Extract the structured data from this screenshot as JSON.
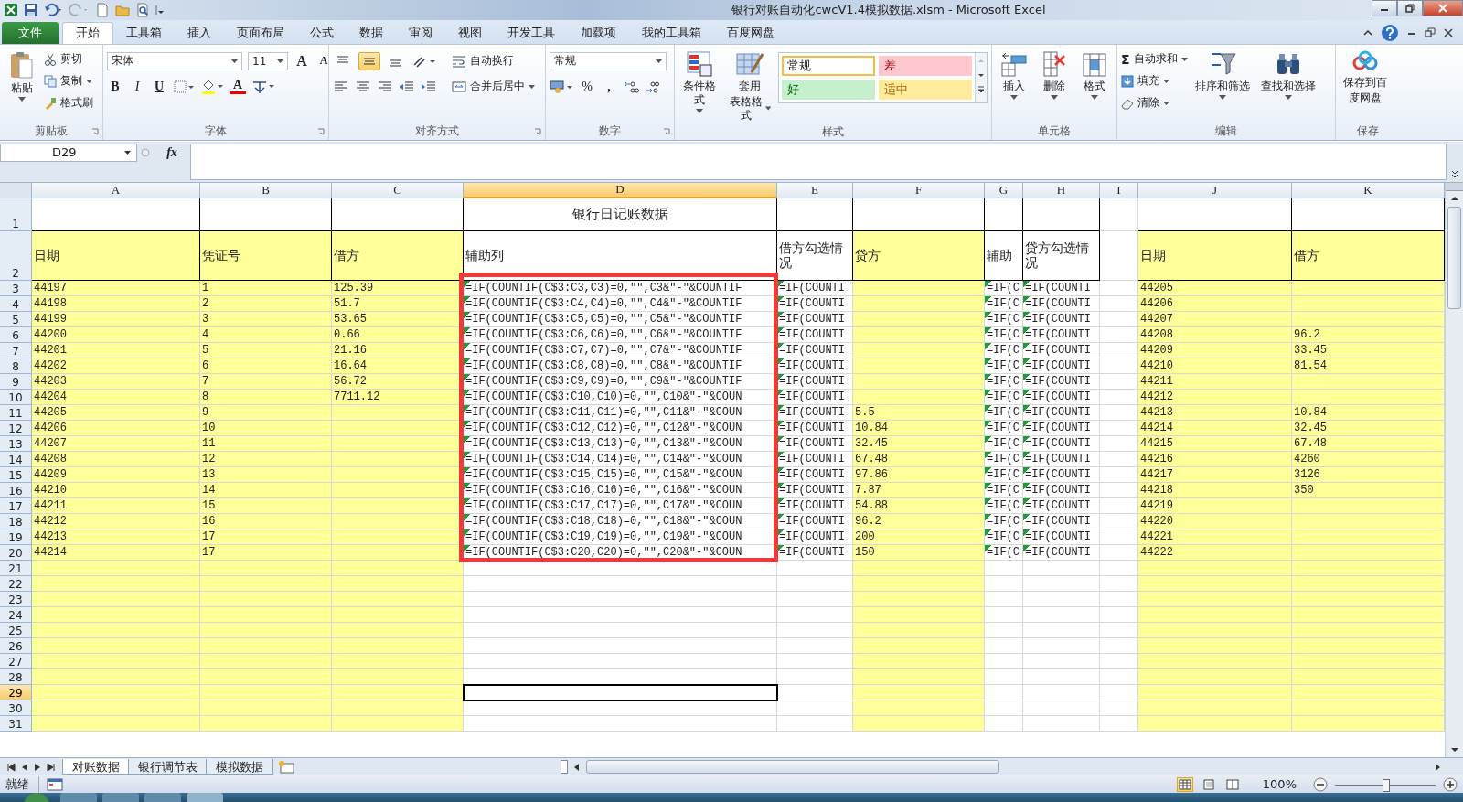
{
  "window": {
    "title": "银行对账自动化cwcV1.4模拟数据.xlsm  -  Microsoft Excel"
  },
  "ribbon_tabs": [
    {
      "label": "文件",
      "kind": "file",
      "selected": false
    },
    {
      "label": "开始",
      "kind": "tab",
      "selected": true
    },
    {
      "label": "工具箱",
      "kind": "tab",
      "selected": false
    },
    {
      "label": "插入",
      "kind": "tab",
      "selected": false
    },
    {
      "label": "页面布局",
      "kind": "tab",
      "selected": false
    },
    {
      "label": "公式",
      "kind": "tab",
      "selected": false
    },
    {
      "label": "数据",
      "kind": "tab",
      "selected": false
    },
    {
      "label": "审阅",
      "kind": "tab",
      "selected": false
    },
    {
      "label": "视图",
      "kind": "tab",
      "selected": false
    },
    {
      "label": "开发工具",
      "kind": "tab",
      "selected": false
    },
    {
      "label": "加载项",
      "kind": "tab",
      "selected": false
    },
    {
      "label": "我的工具箱",
      "kind": "tab",
      "selected": false
    },
    {
      "label": "百度网盘",
      "kind": "tab",
      "selected": false
    }
  ],
  "clipboard": {
    "paste": "粘贴",
    "cut": "剪切",
    "copy": "复制",
    "format_painter": "格式刷",
    "label": "剪贴板"
  },
  "font": {
    "name": "宋体",
    "size": "11",
    "grow": "A",
    "shrink": "A",
    "bold": "B",
    "italic": "I",
    "underline": "U",
    "font_color_button": "A",
    "label": "字体"
  },
  "alignment": {
    "vertical": [
      {
        "selected": false
      },
      {
        "selected": true
      },
      {
        "selected": false
      }
    ],
    "wrap": "自动换行",
    "merge": "合并后居中",
    "label": "对齐方式"
  },
  "number": {
    "format": "常规",
    "percent": "%",
    "comma": ",",
    "label": "数字"
  },
  "styles": {
    "conditional": "条件格式",
    "table_format": [
      "套用",
      "表格格式"
    ],
    "gallery": [
      {
        "label": "常规",
        "kind": "normal",
        "selected": true
      },
      {
        "label": "差",
        "kind": "bad",
        "selected": false
      },
      {
        "label": "好",
        "kind": "good",
        "selected": false
      },
      {
        "label": "适中",
        "kind": "neutral",
        "selected": false
      }
    ],
    "label": "样式"
  },
  "cells": {
    "insert": "插入",
    "delete": "删除",
    "format": "格式",
    "label": "单元格"
  },
  "editing": {
    "sigma": "Σ",
    "autosum": "自动求和",
    "fill": "填充",
    "clear": "清除",
    "sort": "排序和筛选",
    "find": "查找和选择",
    "label": "编辑"
  },
  "save": {
    "button": [
      "保存到百",
      "度网盘"
    ],
    "label": "保存"
  },
  "name_box": "D29",
  "formula_bar": {
    "label": "fx"
  },
  "sheet": {
    "columns": [
      {
        "label": "A",
        "kind": "filled",
        "selected": false
      },
      {
        "label": "B",
        "kind": "filled",
        "selected": false
      },
      {
        "label": "C",
        "kind": "filled",
        "selected": false
      },
      {
        "label": "D",
        "kind": "plain",
        "selected": true
      },
      {
        "label": "E",
        "kind": "plain",
        "selected": false
      },
      {
        "label": "F",
        "kind": "filled",
        "selected": false
      },
      {
        "label": "G",
        "kind": "plain",
        "selected": false
      },
      {
        "label": "H",
        "kind": "plain",
        "selected": false
      },
      {
        "label": "I",
        "kind": "spacer",
        "selected": false
      },
      {
        "label": "J",
        "kind": "filled",
        "selected": false
      },
      {
        "label": "K",
        "kind": "filled",
        "selected": false
      }
    ],
    "rows": [
      {
        "number": "1",
        "kind": "header",
        "selected": false,
        "cells": {
          "D": {
            "text": "银行日记账数据",
            "kind": "title"
          }
        }
      },
      {
        "number": "2",
        "kind": "header",
        "selected": false,
        "cells": {
          "A": "日期",
          "B": "凭证号",
          "C": "借方",
          "D": "辅助列",
          "E": "借方勾选情况",
          "F": "贷方",
          "G": "辅助",
          "H": "贷方勾选情况",
          "J": "日期",
          "K": "借方"
        }
      },
      {
        "number": "3",
        "kind": "data",
        "selected": false,
        "cells": {
          "A": "44197",
          "B": "1",
          "C": "125.39",
          "D": {
            "text": "=IF(COUNTIF(C$3:C3,C3)=0,\"\",C3&\"-\"&COUNTIF",
            "flagged": true
          },
          "E": {
            "text": "=IF(COUNTI",
            "flagged": true
          },
          "G": {
            "text": "=IF(C",
            "flagged": true
          },
          "H": {
            "text": "=IF(COUNTI",
            "flagged": true
          },
          "J": "44205"
        }
      },
      {
        "number": "4",
        "kind": "data",
        "selected": false,
        "cells": {
          "A": "44198",
          "B": "2",
          "C": "51.7",
          "D": {
            "text": "=IF(COUNTIF(C$3:C4,C4)=0,\"\",C4&\"-\"&COUNTIF",
            "flagged": true
          },
          "E": {
            "text": "=IF(COUNTI",
            "flagged": true
          },
          "G": {
            "text": "=IF(C",
            "flagged": true
          },
          "H": {
            "text": "=IF(COUNTI",
            "flagged": true
          },
          "J": "44206"
        }
      },
      {
        "number": "5",
        "kind": "data",
        "selected": false,
        "cells": {
          "A": "44199",
          "B": "3",
          "C": "53.65",
          "D": {
            "text": "=IF(COUNTIF(C$3:C5,C5)=0,\"\",C5&\"-\"&COUNTIF",
            "flagged": true
          },
          "E": {
            "text": "=IF(COUNTI",
            "flagged": true
          },
          "G": {
            "text": "=IF(C",
            "flagged": true
          },
          "H": {
            "text": "=IF(COUNTI",
            "flagged": true
          },
          "J": "44207"
        }
      },
      {
        "number": "6",
        "kind": "data",
        "selected": false,
        "cells": {
          "A": "44200",
          "B": "4",
          "C": "0.66",
          "D": {
            "text": "=IF(COUNTIF(C$3:C6,C6)=0,\"\",C6&\"-\"&COUNTIF",
            "flagged": true
          },
          "E": {
            "text": "=IF(COUNTI",
            "flagged": true
          },
          "G": {
            "text": "=IF(C",
            "flagged": true
          },
          "H": {
            "text": "=IF(COUNTI",
            "flagged": true
          },
          "J": "44208",
          "K": "96.2"
        }
      },
      {
        "number": "7",
        "kind": "data",
        "selected": false,
        "cells": {
          "A": "44201",
          "B": "5",
          "C": "21.16",
          "D": {
            "text": "=IF(COUNTIF(C$3:C7,C7)=0,\"\",C7&\"-\"&COUNTIF",
            "flagged": true
          },
          "E": {
            "text": "=IF(COUNTI",
            "flagged": true
          },
          "G": {
            "text": "=IF(C",
            "flagged": true
          },
          "H": {
            "text": "=IF(COUNTI",
            "flagged": true
          },
          "J": "44209",
          "K": "33.45"
        }
      },
      {
        "number": "8",
        "kind": "data",
        "selected": false,
        "cells": {
          "A": "44202",
          "B": "6",
          "C": "16.64",
          "D": {
            "text": "=IF(COUNTIF(C$3:C8,C8)=0,\"\",C8&\"-\"&COUNTIF",
            "flagged": true
          },
          "E": {
            "text": "=IF(COUNTI",
            "flagged": true
          },
          "G": {
            "text": "=IF(C",
            "flagged": true
          },
          "H": {
            "text": "=IF(COUNTI",
            "flagged": true
          },
          "J": "44210",
          "K": "81.54"
        }
      },
      {
        "number": "9",
        "kind": "data",
        "selected": false,
        "cells": {
          "A": "44203",
          "B": "7",
          "C": "56.72",
          "D": {
            "text": "=IF(COUNTIF(C$3:C9,C9)=0,\"\",C9&\"-\"&COUNTIF",
            "flagged": true
          },
          "E": {
            "text": "=IF(COUNTI",
            "flagged": true
          },
          "G": {
            "text": "=IF(C",
            "flagged": true
          },
          "H": {
            "text": "=IF(COUNTI",
            "flagged": true
          },
          "J": "44211"
        }
      },
      {
        "number": "10",
        "kind": "data",
        "selected": false,
        "cells": {
          "A": "44204",
          "B": "8",
          "C": "7711.12",
          "D": {
            "text": "=IF(COUNTIF(C$3:C10,C10)=0,\"\",C10&\"-\"&COUN",
            "flagged": true
          },
          "E": {
            "text": "=IF(COUNTI",
            "flagged": true
          },
          "G": {
            "text": "=IF(C",
            "flagged": true
          },
          "H": {
            "text": "=IF(COUNTI",
            "flagged": true
          },
          "J": "44212"
        }
      },
      {
        "number": "11",
        "kind": "data",
        "selected": false,
        "cells": {
          "A": "44205",
          "B": "9",
          "D": {
            "text": "=IF(COUNTIF(C$3:C11,C11)=0,\"\",C11&\"-\"&COUN",
            "flagged": true
          },
          "E": {
            "text": "=IF(COUNTI",
            "flagged": true
          },
          "F": "5.5",
          "G": {
            "text": "=IF(C",
            "flagged": true
          },
          "H": {
            "text": "=IF(COUNTI",
            "flagged": true
          },
          "J": "44213",
          "K": "10.84"
        }
      },
      {
        "number": "12",
        "kind": "data",
        "selected": false,
        "cells": {
          "A": "44206",
          "B": "10",
          "D": {
            "text": "=IF(COUNTIF(C$3:C12,C12)=0,\"\",C12&\"-\"&COUN",
            "flagged": true
          },
          "E": {
            "text": "=IF(COUNTI",
            "flagged": true
          },
          "F": "10.84",
          "G": {
            "text": "=IF(C",
            "flagged": true
          },
          "H": {
            "text": "=IF(COUNTI",
            "flagged": true
          },
          "J": "44214",
          "K": "32.45"
        }
      },
      {
        "number": "13",
        "kind": "data",
        "selected": false,
        "cells": {
          "A": "44207",
          "B": "11",
          "D": {
            "text": "=IF(COUNTIF(C$3:C13,C13)=0,\"\",C13&\"-\"&COUN",
            "flagged": true
          },
          "E": {
            "text": "=IF(COUNTI",
            "flagged": true
          },
          "F": "32.45",
          "G": {
            "text": "=IF(C",
            "flagged": true
          },
          "H": {
            "text": "=IF(COUNTI",
            "flagged": true
          },
          "J": "44215",
          "K": "67.48"
        }
      },
      {
        "number": "14",
        "kind": "data",
        "selected": false,
        "cells": {
          "A": "44208",
          "B": "12",
          "D": {
            "text": "=IF(COUNTIF(C$3:C14,C14)=0,\"\",C14&\"-\"&COUN",
            "flagged": true
          },
          "E": {
            "text": "=IF(COUNTI",
            "flagged": true
          },
          "F": "67.48",
          "G": {
            "text": "=IF(C",
            "flagged": true
          },
          "H": {
            "text": "=IF(COUNTI",
            "flagged": true
          },
          "J": "44216",
          "K": "4260"
        }
      },
      {
        "number": "15",
        "kind": "data",
        "selected": false,
        "cells": {
          "A": "44209",
          "B": "13",
          "D": {
            "text": "=IF(COUNTIF(C$3:C15,C15)=0,\"\",C15&\"-\"&COUN",
            "flagged": true
          },
          "E": {
            "text": "=IF(COUNTI",
            "flagged": true
          },
          "F": "97.86",
          "G": {
            "text": "=IF(C",
            "flagged": true
          },
          "H": {
            "text": "=IF(COUNTI",
            "flagged": true
          },
          "J": "44217",
          "K": "3126"
        }
      },
      {
        "number": "16",
        "kind": "data",
        "selected": false,
        "cells": {
          "A": "44210",
          "B": "14",
          "D": {
            "text": "=IF(COUNTIF(C$3:C16,C16)=0,\"\",C16&\"-\"&COUN",
            "flagged": true
          },
          "E": {
            "text": "=IF(COUNTI",
            "flagged": true
          },
          "F": "7.87",
          "G": {
            "text": "=IF(C",
            "flagged": true
          },
          "H": {
            "text": "=IF(COUNTI",
            "flagged": true
          },
          "J": "44218",
          "K": "350"
        }
      },
      {
        "number": "17",
        "kind": "data",
        "selected": false,
        "cells": {
          "A": "44211",
          "B": "15",
          "D": {
            "text": "=IF(COUNTIF(C$3:C17,C17)=0,\"\",C17&\"-\"&COUN",
            "flagged": true
          },
          "E": {
            "text": "=IF(COUNTI",
            "flagged": true
          },
          "F": "54.88",
          "G": {
            "text": "=IF(C",
            "flagged": true
          },
          "H": {
            "text": "=IF(COUNTI",
            "flagged": true
          },
          "J": "44219"
        }
      },
      {
        "number": "18",
        "kind": "data",
        "selected": false,
        "cells": {
          "A": "44212",
          "B": "16",
          "D": {
            "text": "=IF(COUNTIF(C$3:C18,C18)=0,\"\",C18&\"-\"&COUN",
            "flagged": true
          },
          "E": {
            "text": "=IF(COUNTI",
            "flagged": true
          },
          "F": "96.2",
          "G": {
            "text": "=IF(C",
            "flagged": true
          },
          "H": {
            "text": "=IF(COUNTI",
            "flagged": true
          },
          "J": "44220"
        }
      },
      {
        "number": "19",
        "kind": "data",
        "selected": false,
        "cells": {
          "A": "44213",
          "B": "17",
          "D": {
            "text": "=IF(COUNTIF(C$3:C19,C19)=0,\"\",C19&\"-\"&COUN",
            "flagged": true
          },
          "E": {
            "text": "=IF(COUNTI",
            "flagged": true
          },
          "F": "200",
          "G": {
            "text": "=IF(C",
            "flagged": true
          },
          "H": {
            "text": "=IF(COUNTI",
            "flagged": true
          },
          "J": "44221"
        }
      },
      {
        "number": "20",
        "kind": "data",
        "selected": false,
        "cells": {
          "A": "44214",
          "B": "17",
          "D": {
            "text": "=IF(COUNTIF(C$3:C20,C20)=0,\"\",C20&\"-\"&COUN",
            "flagged": true
          },
          "E": {
            "text": "=IF(COUNTI",
            "flagged": true
          },
          "F": "150",
          "G": {
            "text": "=IF(C",
            "flagged": true
          },
          "H": {
            "text": "=IF(COUNTI",
            "flagged": true
          },
          "J": "44222"
        }
      },
      {
        "number": "21",
        "kind": "data",
        "selected": false
      },
      {
        "number": "22",
        "kind": "data",
        "selected": false
      },
      {
        "number": "23",
        "kind": "data",
        "selected": false
      },
      {
        "number": "24",
        "kind": "data",
        "selected": false
      },
      {
        "number": "25",
        "kind": "data",
        "selected": false
      },
      {
        "number": "26",
        "kind": "data",
        "selected": false
      },
      {
        "number": "27",
        "kind": "data",
        "selected": false
      },
      {
        "number": "28",
        "kind": "data",
        "selected": false
      },
      {
        "number": "29",
        "kind": "data",
        "selected": true
      },
      {
        "number": "30",
        "kind": "data",
        "selected": false
      },
      {
        "number": "31",
        "kind": "data",
        "selected": false
      }
    ]
  },
  "sheet_tabs": [
    {
      "label": "对账数据",
      "selected": true
    },
    {
      "label": "银行调节表",
      "selected": false
    },
    {
      "label": "模拟数据",
      "selected": false
    }
  ],
  "status_bar": {
    "ready": "就绪",
    "views": [
      {
        "selected": true
      },
      {
        "selected": false
      },
      {
        "selected": false
      }
    ],
    "zoom": "100%",
    "zoom_slider": {
      "level": 0.5
    }
  }
}
